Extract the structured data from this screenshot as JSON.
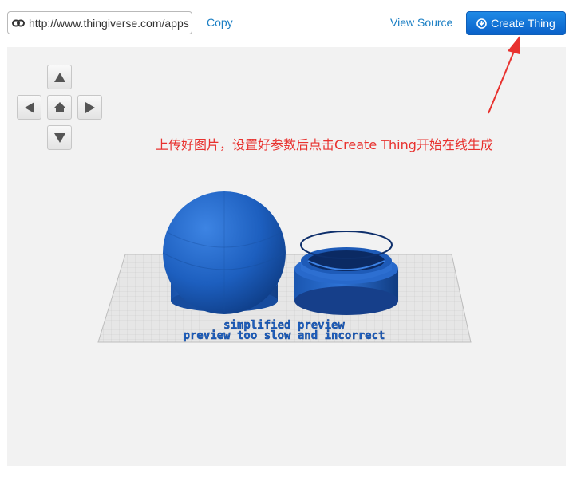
{
  "toolbar": {
    "url_value": "http://www.thingiverse.com/apps",
    "copy_label": "Copy",
    "view_source_label": "View Source",
    "create_button_label": "Create Thing"
  },
  "icons": {
    "url": "link-icon",
    "create": "download-circle-icon",
    "nav_up": "arrow-up-icon",
    "nav_left": "arrow-left-icon",
    "nav_home": "home-icon",
    "nav_right": "arrow-right-icon",
    "nav_down": "arrow-down-icon"
  },
  "viewer": {
    "annotation": "上传好图片，设置好参数后点击Create Thing开始在线生成",
    "preview_line1": "simplified preview",
    "preview_line2": "preview too slow and incorrect"
  },
  "colors": {
    "primary_button": "#0a61c9",
    "link": "#1b7fc4",
    "annotation": "#e8322f",
    "model": "#1d5fbf",
    "viewport_bg": "#f2f2f2"
  }
}
